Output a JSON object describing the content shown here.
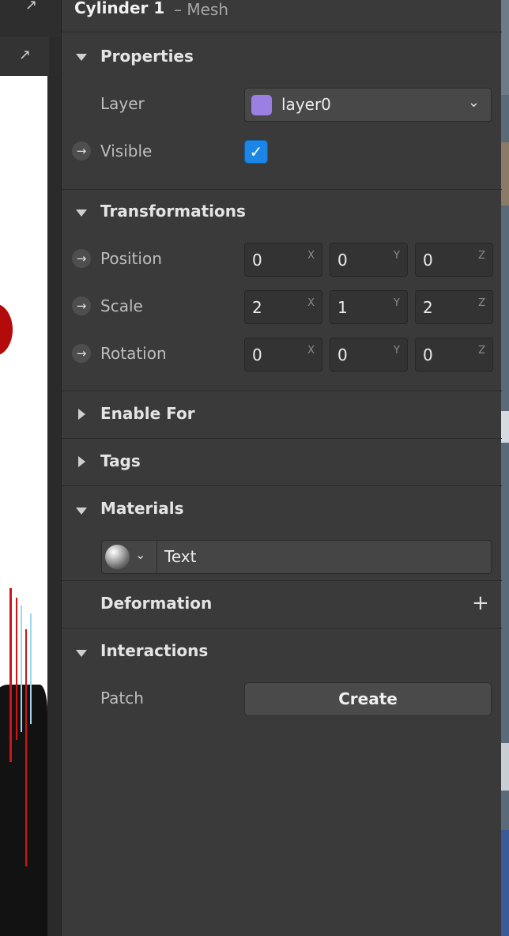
{
  "header": {
    "title": "Cylinder 1",
    "subtitle": "– Mesh"
  },
  "sections": {
    "properties": {
      "title": "Properties",
      "layer": {
        "label": "Layer",
        "value": "layer0",
        "swatch_color": "#9b7fe2"
      },
      "visible": {
        "label": "Visible",
        "checked": true,
        "check_glyph": "✓"
      }
    },
    "transformations": {
      "title": "Transformations",
      "rows": [
        {
          "label": "Position",
          "x": "0",
          "y": "0",
          "z": "0"
        },
        {
          "label": "Scale",
          "x": "2",
          "y": "1",
          "z": "2"
        },
        {
          "label": "Rotation",
          "x": "0",
          "y": "0",
          "z": "0"
        }
      ],
      "axes": {
        "x": "X",
        "y": "Y",
        "z": "Z"
      }
    },
    "enable_for": {
      "title": "Enable For"
    },
    "tags": {
      "title": "Tags"
    },
    "materials": {
      "title": "Materials",
      "material_name": "Text"
    },
    "deformation": {
      "title": "Deformation",
      "add_glyph": "+"
    },
    "interactions": {
      "title": "Interactions",
      "patch_label": "Patch",
      "create_label": "Create"
    }
  },
  "icons": {
    "external_link": "↗",
    "arrow_right": "→",
    "chevron_down": "⌄"
  },
  "colors": {
    "accent": "#1b86e6",
    "panel_bg": "#3a3a3a"
  }
}
